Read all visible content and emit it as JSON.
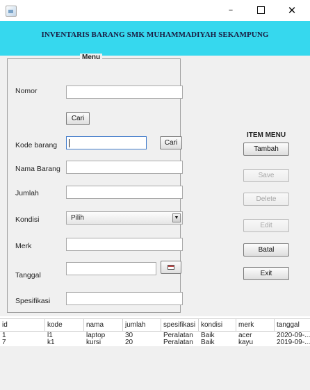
{
  "window": {
    "controls": {
      "minimize": "–",
      "maximize": "",
      "close": "✕"
    }
  },
  "banner": {
    "title": "INVENTARIS BARANG SMK MUHAMMADIYAH SEKAMPUNG",
    "background": "#36d8ee"
  },
  "form": {
    "legend": "Menu",
    "nomor_label": "Nomor",
    "nomor_value": "",
    "cari_button": "Cari",
    "kode_label": "Kode barang",
    "kode_value": "",
    "kode_cari_button": "Cari",
    "nama_label": "Nama Barang",
    "nama_value": "",
    "jumlah_label": "Jumlah",
    "jumlah_value": "",
    "kondisi_label": "Kondisi",
    "kondisi_selected": "Pilih",
    "merk_label": "Merk",
    "merk_value": "",
    "tanggal_label": "Tanggal",
    "tanggal_value": "",
    "spesifikasi_label": "Spesifikasi",
    "spesifikasi_value": ""
  },
  "item_menu": {
    "title": "ITEM MENU",
    "buttons": [
      {
        "label": "Tambah",
        "enabled": true
      },
      {
        "label": "Save",
        "enabled": false
      },
      {
        "label": "Delete",
        "enabled": false
      },
      {
        "label": "Edit",
        "enabled": false
      },
      {
        "label": "Batal",
        "enabled": true
      },
      {
        "label": "Exit",
        "enabled": true
      }
    ]
  },
  "table": {
    "columns": [
      "id",
      "kode",
      "nama",
      "jumlah",
      "spesifikasi",
      "kondisi",
      "merk",
      "tanggal"
    ],
    "rows": [
      [
        "1",
        "l1",
        "laptop",
        "30",
        "Peralatan",
        "Baik",
        "acer",
        "2020-09-..."
      ],
      [
        "7",
        "k1",
        "kursi",
        "20",
        "Peralatan",
        "Baik",
        "kayu",
        "2019-09-..."
      ]
    ]
  },
  "icons": {
    "app": "app-window-icon",
    "calendar": "calendar-icon",
    "dropdown": "dropdown-arrow-icon"
  }
}
